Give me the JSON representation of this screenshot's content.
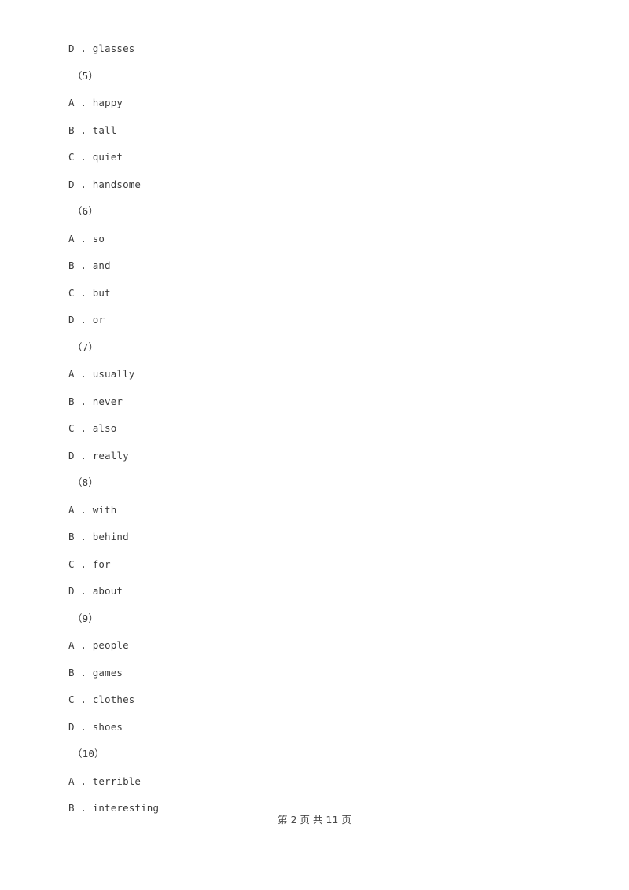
{
  "document": {
    "page_background": "#ffffff",
    "text_color": "#3b3b3b",
    "footer_color": "#4a4a4a"
  },
  "lines": [
    {
      "type": "option",
      "text": "D . glasses"
    },
    {
      "type": "qnum",
      "text": "（5）"
    },
    {
      "type": "option",
      "text": "A . happy"
    },
    {
      "type": "option",
      "text": "B . tall"
    },
    {
      "type": "option",
      "text": "C . quiet"
    },
    {
      "type": "option",
      "text": "D . handsome"
    },
    {
      "type": "qnum",
      "text": "（6）"
    },
    {
      "type": "option",
      "text": "A . so"
    },
    {
      "type": "option",
      "text": "B . and"
    },
    {
      "type": "option",
      "text": "C . but"
    },
    {
      "type": "option",
      "text": "D . or"
    },
    {
      "type": "qnum",
      "text": "（7）"
    },
    {
      "type": "option",
      "text": "A . usually"
    },
    {
      "type": "option",
      "text": "B . never"
    },
    {
      "type": "option",
      "text": "C . also"
    },
    {
      "type": "option",
      "text": "D . really"
    },
    {
      "type": "qnum",
      "text": "（8）"
    },
    {
      "type": "option",
      "text": "A . with"
    },
    {
      "type": "option",
      "text": "B . behind"
    },
    {
      "type": "option",
      "text": "C . for"
    },
    {
      "type": "option",
      "text": "D . about"
    },
    {
      "type": "qnum",
      "text": "（9）"
    },
    {
      "type": "option",
      "text": "A . people"
    },
    {
      "type": "option",
      "text": "B . games"
    },
    {
      "type": "option",
      "text": "C . clothes"
    },
    {
      "type": "option",
      "text": "D . shoes"
    },
    {
      "type": "qnum",
      "text": "（10）"
    },
    {
      "type": "option",
      "text": "A . terrible"
    },
    {
      "type": "option",
      "text": "B . interesting"
    }
  ],
  "footer": {
    "text": "第 2 页 共 11 页",
    "current_page": "2",
    "total_pages": "11"
  }
}
